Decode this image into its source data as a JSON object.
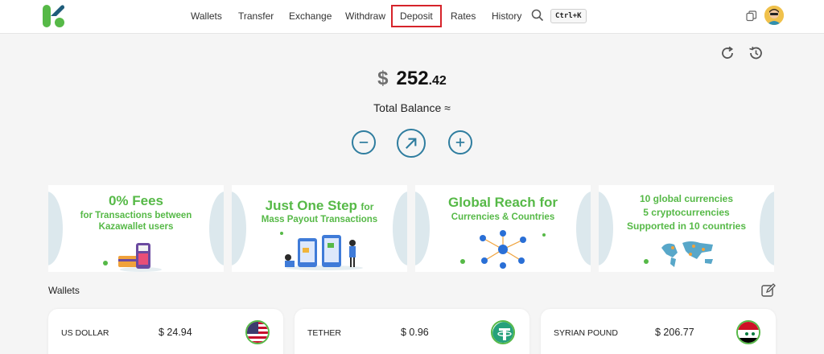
{
  "header": {
    "nav": [
      "Wallets",
      "Transfer",
      "Exchange",
      "Withdraw",
      "Deposit",
      "Rates",
      "History"
    ],
    "selected_nav": "Deposit",
    "shortcut": "Ctrl+K",
    "icons": {
      "search": "search-icon",
      "copy": "copy-icon",
      "avatar": "user-avatar"
    }
  },
  "balance": {
    "currency_symbol": "$",
    "integer": "252",
    "decimal": ".42",
    "label": "Total Balance ≈"
  },
  "actions": [
    "minus-circle-icon",
    "send-arrow-icon",
    "plus-circle-icon"
  ],
  "banners": [
    {
      "line1": "0% Fees",
      "line2": "for Transactions between",
      "line3": "Kazawallet users"
    },
    {
      "line1": "Just One Step",
      "line1_suffix": "for",
      "line2": "Mass Payout Transactions"
    },
    {
      "line1": "Global Reach for",
      "line2": "Currencies & Countries"
    },
    {
      "line1": "10 global currencies",
      "line2": "5 cryptocurrencies",
      "line3": "Supported in 10 countries"
    }
  ],
  "wallets": {
    "title": "Wallets",
    "items": [
      {
        "name": "US DOLLAR",
        "amount": "$ 24.94",
        "flag": "us-flag-icon"
      },
      {
        "name": "TETHER",
        "amount": "$ 0.96",
        "flag": "tether-icon"
      },
      {
        "name": "SYRIAN POUND",
        "amount": "$ 206.77",
        "flag": "syria-flag-icon"
      }
    ]
  },
  "colors": {
    "brand_green": "#56b947",
    "accent_blue": "#2f7d9f",
    "selected_outline": "#d6232a"
  }
}
